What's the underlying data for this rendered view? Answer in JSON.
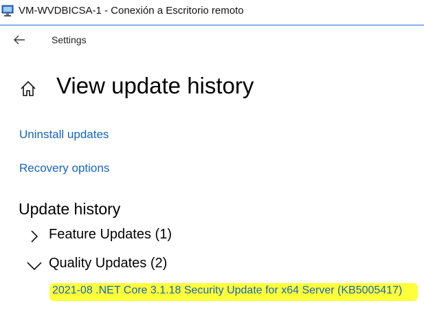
{
  "window": {
    "title": "VM-WVDBICSA-1 - Conexión a Escritorio remoto"
  },
  "header": {
    "settings_label": "Settings"
  },
  "page": {
    "title": "View update history"
  },
  "links": {
    "uninstall": "Uninstall updates",
    "recovery": "Recovery options"
  },
  "history": {
    "heading": "Update history",
    "groups": [
      {
        "label": "Feature Updates (1)",
        "expanded": false
      },
      {
        "label": "Quality Updates (2)",
        "expanded": true
      }
    ],
    "items": [
      {
        "label": "2021-08 .NET Core 3.1.18 Security Update for x64 Server (KB5005417)",
        "highlight": "#ffff3a"
      }
    ]
  },
  "colors": {
    "link": "#1565c0",
    "accent_line": "#1f6fd1"
  }
}
